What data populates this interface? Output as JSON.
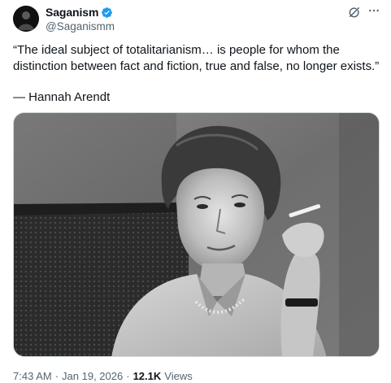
{
  "author": {
    "display_name": "Saganism",
    "handle": "@Saganismm",
    "verified": true,
    "verified_color": "#1d9bf0"
  },
  "tweet": {
    "text": "“The ideal subject of totalitarianism… is people for whom the distinction between fact and fiction, true and false, no longer exists.”",
    "attribution": "— Hannah Arendt"
  },
  "media": {
    "kind": "black-and-white portrait photo"
  },
  "meta": {
    "time": "7:43 AM",
    "separator": "·",
    "date": "Jan 19, 2026",
    "views_count": "12.1K",
    "views_label": "Views"
  },
  "icons": {
    "grok": "grok-icon",
    "more": "more-icon",
    "verified": "verified-badge-icon"
  },
  "colors": {
    "text_primary": "#0f1419",
    "text_secondary": "#536471",
    "border": "#cfd9de"
  }
}
